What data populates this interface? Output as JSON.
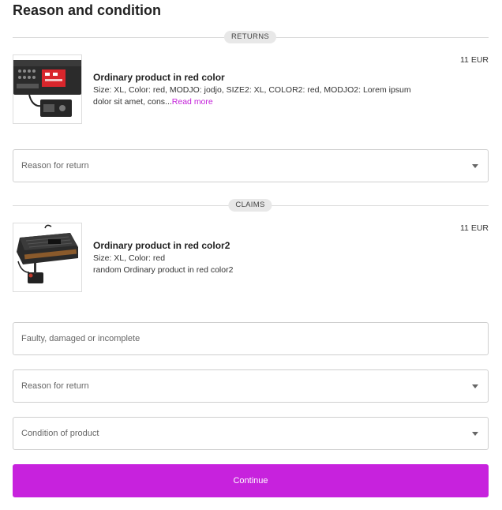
{
  "page": {
    "title": "Reason and condition"
  },
  "sections": {
    "returns_label": "RETURNS",
    "claims_label": "CLAIMS"
  },
  "products": [
    {
      "name": "Ordinary product in red color",
      "description": "Size: XL, Color: red, MODJO: jodjo, SIZE2: XL, COLOR2: red, MODJO2: Lorem ipsum dolor sit amet, cons...",
      "read_more": "Read more",
      "price": "11 EUR",
      "image": "red-synth-product-image"
    },
    {
      "name": "Ordinary product in red color2",
      "description_line1": "Size: XL, Color: red",
      "description_line2": "random Ordinary product in red color2",
      "price": "11 EUR",
      "image": "retro-console-product-image"
    }
  ],
  "fields": {
    "returns_reason": {
      "placeholder": "Reason for return",
      "icon": "chevron-down-icon"
    },
    "claims_problem": {
      "placeholder": "Faulty, damaged or incomplete"
    },
    "claims_reason": {
      "placeholder": "Reason for return",
      "icon": "chevron-down-icon"
    },
    "claims_condition": {
      "placeholder": "Condition of product",
      "icon": "chevron-down-icon"
    }
  },
  "actions": {
    "continue_label": "Continue"
  },
  "colors": {
    "accent": "#c722dd",
    "link": "#c21ed8"
  }
}
